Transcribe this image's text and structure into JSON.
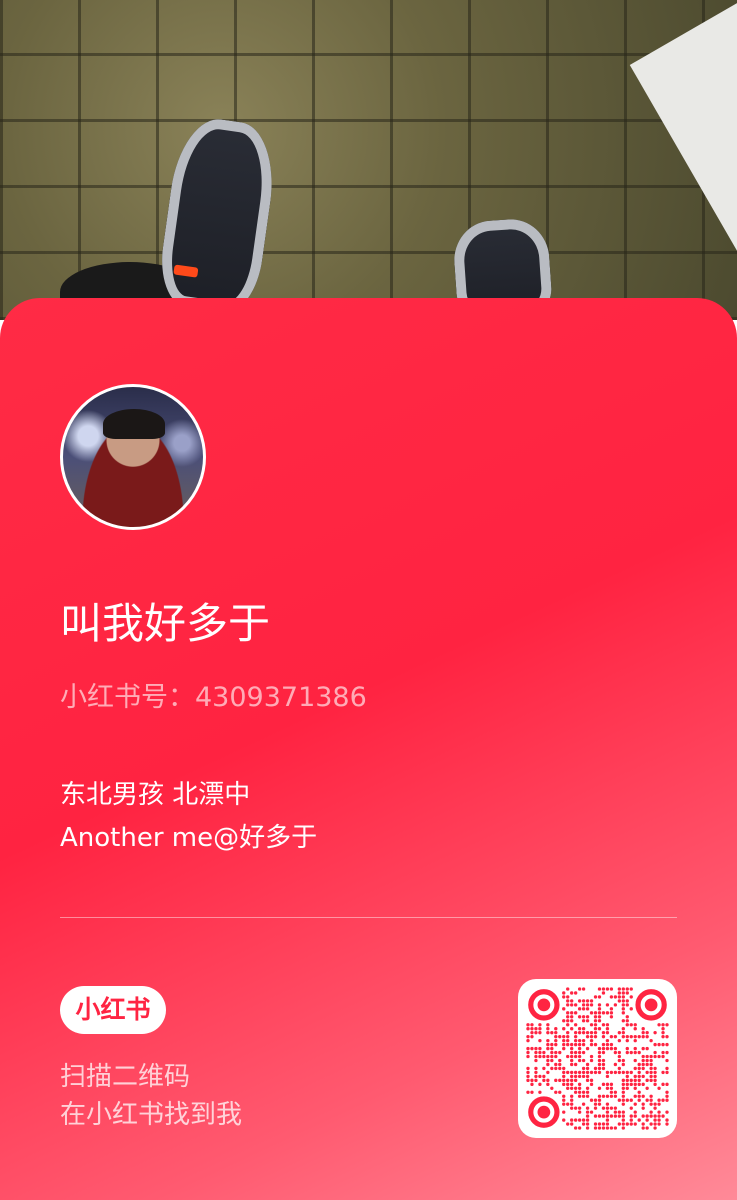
{
  "profile": {
    "name": "叫我好多于",
    "red_id": "小红书号：4309371386",
    "bio_line_1": "东北男孩 北漂中",
    "bio_line_2": "Another me@好多于"
  },
  "footer": {
    "logo_text": "小红书",
    "scan_line_1": "扫描二维码",
    "scan_line_2": "在小红书找到我"
  },
  "colors": {
    "brand_red": "#ff2442",
    "qr_color": "#ff2442"
  }
}
